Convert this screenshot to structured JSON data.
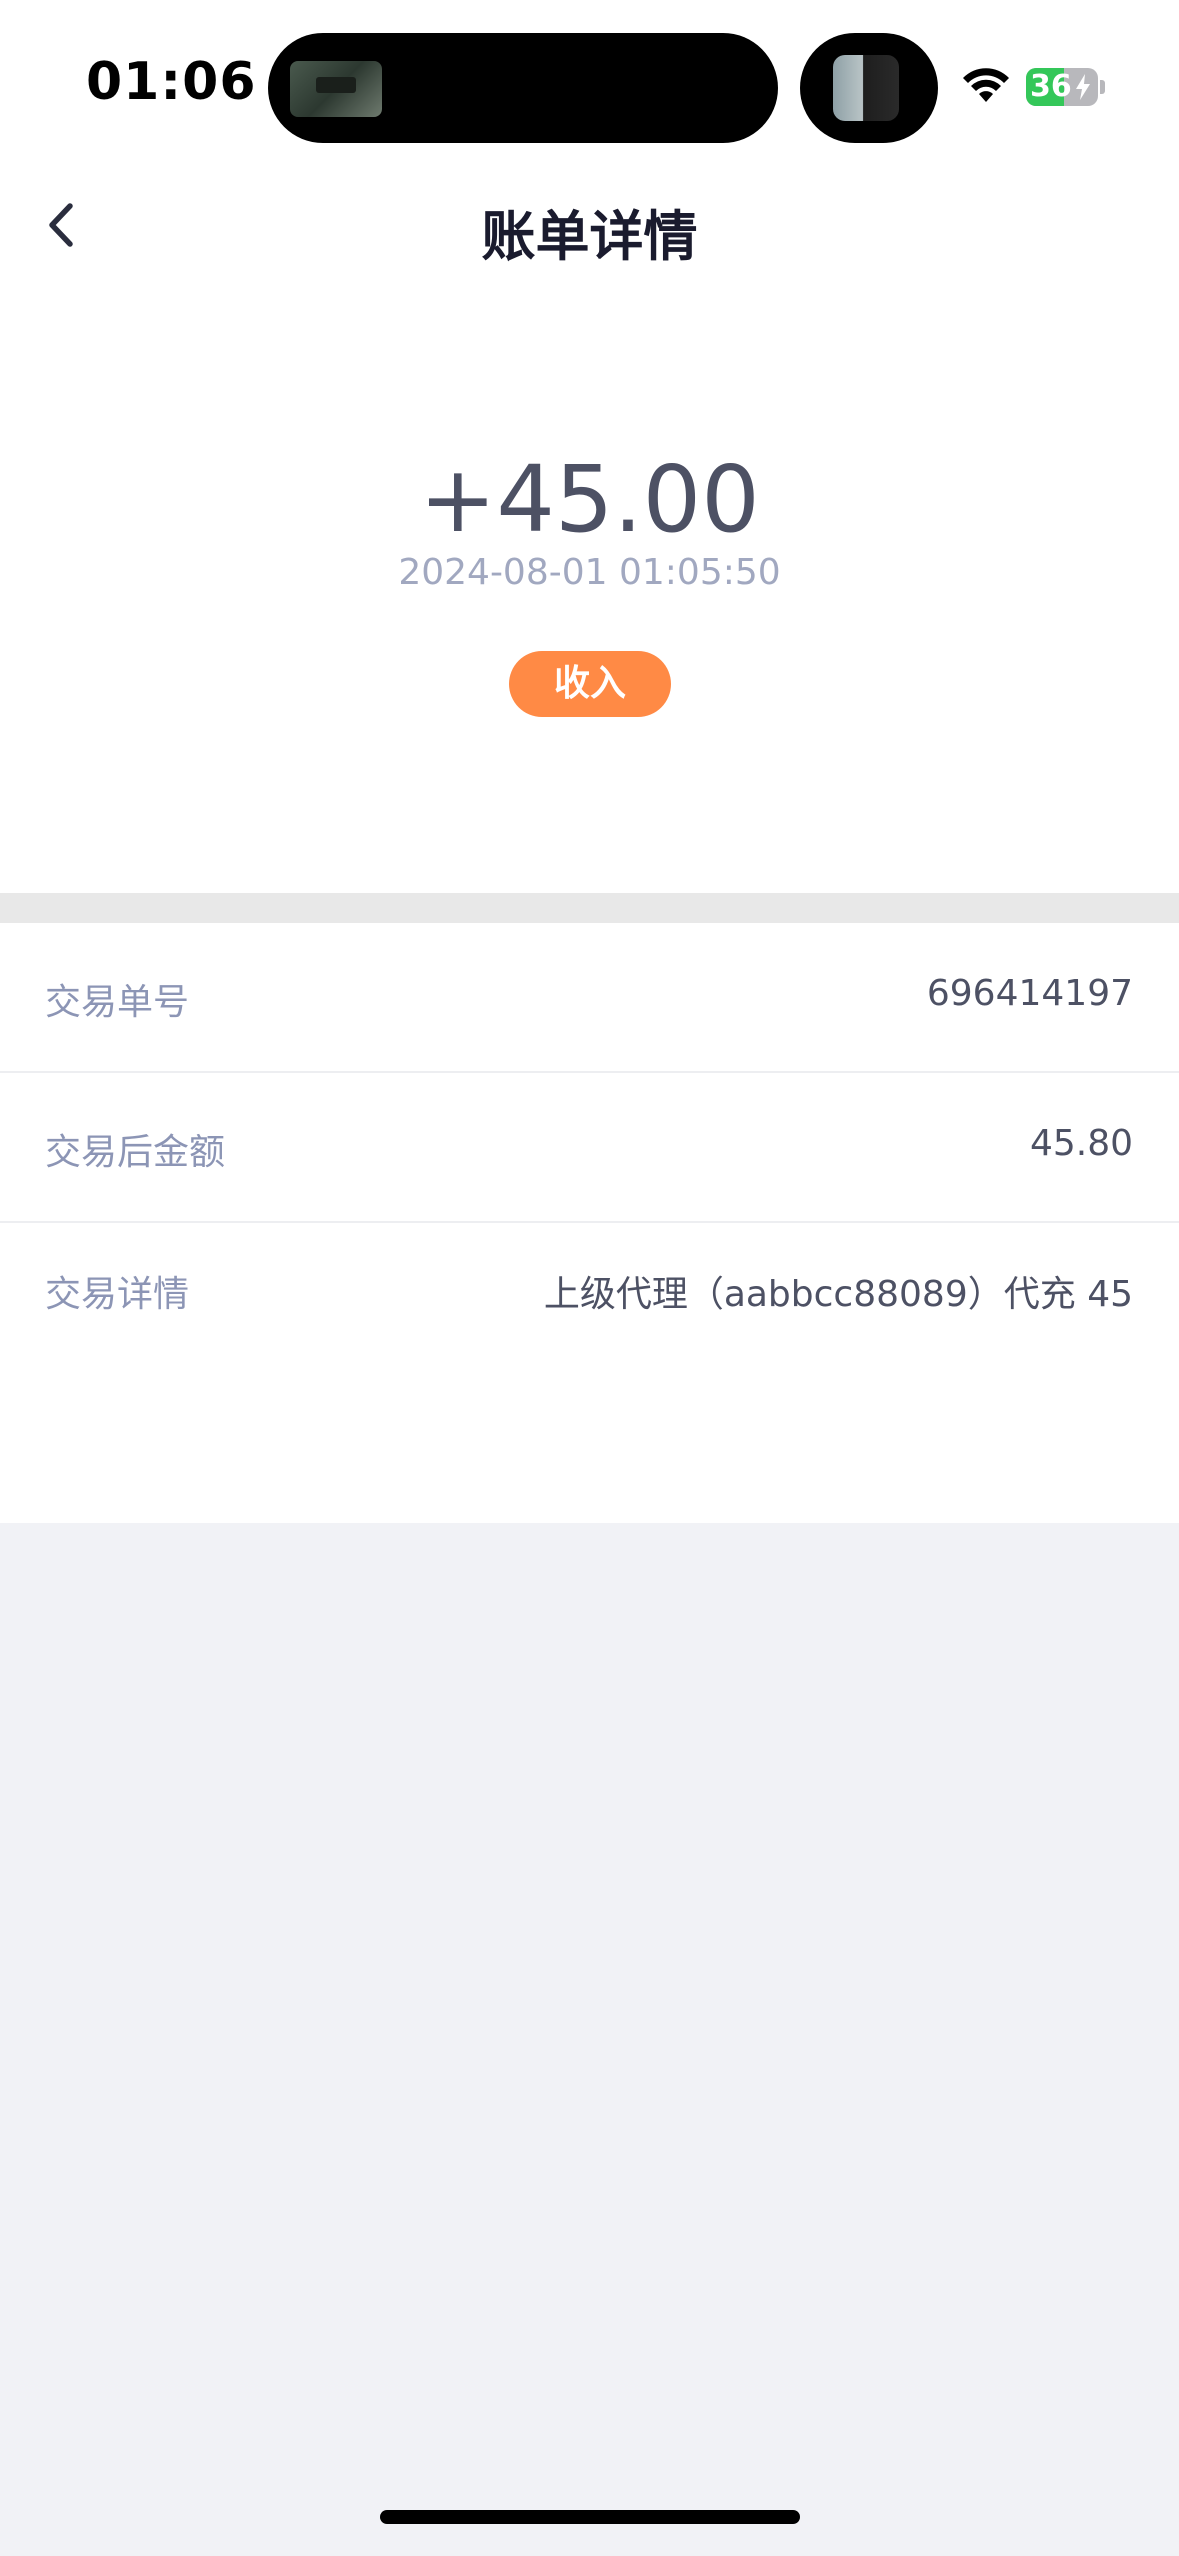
{
  "status_bar": {
    "time": "01:06",
    "battery_level": "36",
    "battery_fraction": 0.36,
    "battery_color": "#34C759",
    "icons": [
      "wifi-icon",
      "battery-charging-icon"
    ]
  },
  "nav": {
    "title": "账单详情",
    "back_icon": "chevron-left-icon"
  },
  "transaction": {
    "amount": "+45.00",
    "datetime": "2024-08-01 01:05:50",
    "type_label": "收入",
    "type_color": "#FF8A45"
  },
  "details": [
    {
      "label": "交易单号",
      "value": "696414197"
    },
    {
      "label": "交易后金额",
      "value": "45.80"
    },
    {
      "label": "交易详情",
      "value": "上级代理（aabbcc88089）代充 45"
    }
  ],
  "colors": {
    "page_background": "#F1F2F6",
    "card_background": "#FFFFFF",
    "label_text": "#8C95B5",
    "value_text": "#4D5164"
  }
}
